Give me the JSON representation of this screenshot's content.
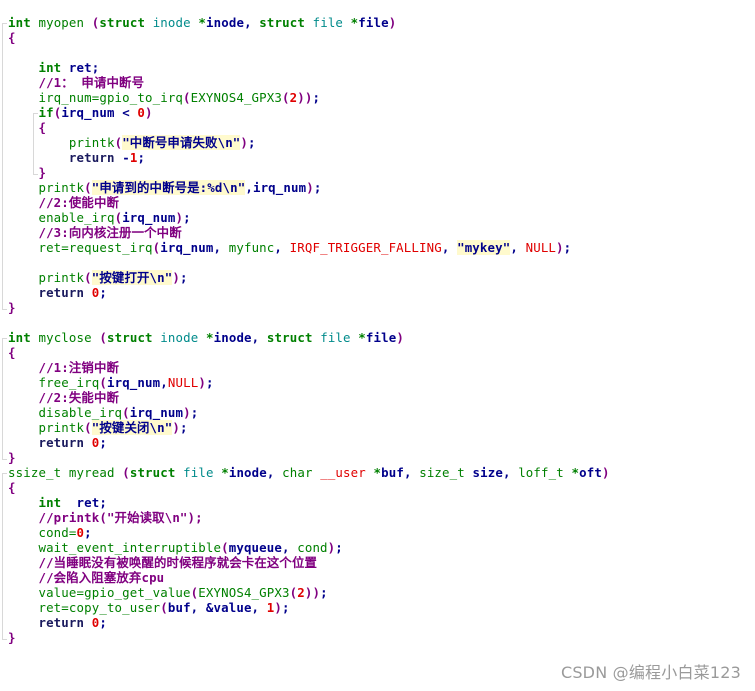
{
  "editor": {
    "colors": {
      "keyword": "#008000",
      "type": "#008b8b",
      "identifier": "#00008b",
      "number": "#e00000",
      "macro": "#e00000",
      "comment": "#800080",
      "string_highlight": "#fffacd"
    },
    "lines": [
      [
        [
          "kw",
          "int"
        ],
        [
          "plain",
          " "
        ],
        [
          "fn",
          "myopen"
        ],
        [
          "plain",
          " "
        ],
        [
          "punc",
          "("
        ],
        [
          "kw",
          "struct"
        ],
        [
          "plain",
          " "
        ],
        [
          "type",
          "inode"
        ],
        [
          "plain",
          " "
        ],
        [
          "kw",
          "*"
        ],
        [
          "ident",
          "inode"
        ],
        [
          "plain",
          ", "
        ],
        [
          "kw",
          "struct"
        ],
        [
          "plain",
          " "
        ],
        [
          "type",
          "file"
        ],
        [
          "plain",
          " "
        ],
        [
          "kw",
          "*"
        ],
        [
          "ident",
          "file"
        ],
        [
          "punc",
          ")"
        ]
      ],
      [
        [
          "punc",
          "{"
        ]
      ],
      [],
      [
        [
          "plain",
          "    "
        ],
        [
          "kw",
          "int"
        ],
        [
          "plain",
          " "
        ],
        [
          "ident",
          "ret;"
        ]
      ],
      [
        [
          "plain",
          "    "
        ],
        [
          "cmt",
          "//1： 申请中断号"
        ]
      ],
      [
        [
          "plain",
          "    "
        ],
        [
          "fn",
          "irq_num=gpio_to_irq"
        ],
        [
          "punc",
          "("
        ],
        [
          "fn",
          "EXYNOS4_GPX3"
        ],
        [
          "punc",
          "("
        ],
        [
          "num",
          "2"
        ],
        [
          "punc",
          "))"
        ],
        [
          "ident",
          ";"
        ]
      ],
      [
        [
          "plain",
          "    "
        ],
        [
          "kw",
          "if"
        ],
        [
          "punc",
          "("
        ],
        [
          "ident",
          "irq_num < "
        ],
        [
          "num",
          "0"
        ],
        [
          "punc",
          ")"
        ]
      ],
      [
        [
          "plain",
          "    "
        ],
        [
          "punc",
          "{"
        ]
      ],
      [
        [
          "plain",
          "        "
        ],
        [
          "fn",
          "printk"
        ],
        [
          "punc",
          "("
        ],
        [
          "str",
          "\"中断号申请失败\\n\""
        ],
        [
          "punc",
          ")"
        ],
        [
          "ident",
          ";"
        ]
      ],
      [
        [
          "plain",
          "        "
        ],
        [
          "ret",
          "return"
        ],
        [
          "plain",
          " "
        ],
        [
          "ident",
          "-"
        ],
        [
          "num",
          "1"
        ],
        [
          "ident",
          ";"
        ]
      ],
      [
        [
          "plain",
          "    "
        ],
        [
          "punc",
          "}"
        ]
      ],
      [
        [
          "plain",
          "    "
        ],
        [
          "fn",
          "printk"
        ],
        [
          "punc",
          "("
        ],
        [
          "str",
          "\"申请到的中断号是:%d\\n\""
        ],
        [
          "ident",
          ",irq_num"
        ],
        [
          "punc",
          ")"
        ],
        [
          "ident",
          ";"
        ]
      ],
      [
        [
          "plain",
          "    "
        ],
        [
          "cmt",
          "//2:使能中断"
        ]
      ],
      [
        [
          "plain",
          "    "
        ],
        [
          "fn",
          "enable_irq"
        ],
        [
          "punc",
          "("
        ],
        [
          "ident",
          "irq_num"
        ],
        [
          "punc",
          ")"
        ],
        [
          "ident",
          ";"
        ]
      ],
      [
        [
          "plain",
          "    "
        ],
        [
          "cmt",
          "//3:向内核注册一个中断"
        ]
      ],
      [
        [
          "plain",
          "    "
        ],
        [
          "fn",
          "ret=request_irq"
        ],
        [
          "punc",
          "("
        ],
        [
          "ident",
          "irq_num, "
        ],
        [
          "fn",
          "myfunc"
        ],
        [
          "ident",
          ", "
        ],
        [
          "red",
          "IRQF_TRIGGER_FALLING"
        ],
        [
          "ident",
          ", "
        ],
        [
          "str",
          "\"mykey\""
        ],
        [
          "ident",
          ", "
        ],
        [
          "red",
          "NULL"
        ],
        [
          "punc",
          ")"
        ],
        [
          "ident",
          ";"
        ]
      ],
      [],
      [
        [
          "plain",
          "    "
        ],
        [
          "fn",
          "printk"
        ],
        [
          "punc",
          "("
        ],
        [
          "str",
          "\"按键打开\\n\""
        ],
        [
          "punc",
          ")"
        ],
        [
          "ident",
          ";"
        ]
      ],
      [
        [
          "plain",
          "    "
        ],
        [
          "ret",
          "return"
        ],
        [
          "plain",
          " "
        ],
        [
          "num",
          "0"
        ],
        [
          "ident",
          ";"
        ]
      ],
      [
        [
          "punc",
          "}"
        ]
      ],
      [],
      [
        [
          "kw",
          "int"
        ],
        [
          "plain",
          " "
        ],
        [
          "fn",
          "myclose"
        ],
        [
          "plain",
          " "
        ],
        [
          "punc",
          "("
        ],
        [
          "kw",
          "struct"
        ],
        [
          "plain",
          " "
        ],
        [
          "type",
          "inode"
        ],
        [
          "plain",
          " "
        ],
        [
          "kw",
          "*"
        ],
        [
          "ident",
          "inode"
        ],
        [
          "plain",
          ", "
        ],
        [
          "kw",
          "struct"
        ],
        [
          "plain",
          " "
        ],
        [
          "type",
          "file"
        ],
        [
          "plain",
          " "
        ],
        [
          "kw",
          "*"
        ],
        [
          "ident",
          "file"
        ],
        [
          "punc",
          ")"
        ]
      ],
      [
        [
          "punc",
          "{"
        ]
      ],
      [
        [
          "plain",
          "    "
        ],
        [
          "cmt",
          "//1:注销中断"
        ]
      ],
      [
        [
          "plain",
          "    "
        ],
        [
          "fn",
          "free_irq"
        ],
        [
          "punc",
          "("
        ],
        [
          "ident",
          "irq_num,"
        ],
        [
          "red",
          "NULL"
        ],
        [
          "punc",
          ")"
        ],
        [
          "ident",
          ";"
        ]
      ],
      [
        [
          "plain",
          "    "
        ],
        [
          "cmt",
          "//2:失能中断"
        ]
      ],
      [
        [
          "plain",
          "    "
        ],
        [
          "fn",
          "disable_irq"
        ],
        [
          "punc",
          "("
        ],
        [
          "ident",
          "irq_num"
        ],
        [
          "punc",
          ")"
        ],
        [
          "ident",
          ";"
        ]
      ],
      [
        [
          "plain",
          "    "
        ],
        [
          "fn",
          "printk"
        ],
        [
          "punc",
          "("
        ],
        [
          "str",
          "\"按键关闭\\n\""
        ],
        [
          "punc",
          ")"
        ],
        [
          "ident",
          ";"
        ]
      ],
      [
        [
          "plain",
          "    "
        ],
        [
          "ret",
          "return"
        ],
        [
          "plain",
          " "
        ],
        [
          "num",
          "0"
        ],
        [
          "ident",
          ";"
        ]
      ],
      [
        [
          "punc",
          "}"
        ]
      ],
      [
        [
          "fn",
          "ssize_t"
        ],
        [
          "plain",
          " "
        ],
        [
          "fn",
          "myread"
        ],
        [
          "plain",
          " "
        ],
        [
          "punc",
          "("
        ],
        [
          "kw",
          "struct"
        ],
        [
          "plain",
          " "
        ],
        [
          "type",
          "file"
        ],
        [
          "plain",
          " "
        ],
        [
          "kw",
          "*"
        ],
        [
          "ident",
          "inode"
        ],
        [
          "plain",
          ", "
        ],
        [
          "fn",
          "char"
        ],
        [
          "plain",
          " "
        ],
        [
          "red",
          "__user"
        ],
        [
          "plain",
          " "
        ],
        [
          "kw",
          "*"
        ],
        [
          "ident",
          "buf"
        ],
        [
          "plain",
          ", "
        ],
        [
          "fn",
          "size_t"
        ],
        [
          "plain",
          " "
        ],
        [
          "ident",
          "size"
        ],
        [
          "plain",
          ", "
        ],
        [
          "fn",
          "loff_t"
        ],
        [
          "plain",
          " "
        ],
        [
          "kw",
          "*"
        ],
        [
          "ident",
          "oft"
        ],
        [
          "punc",
          ")"
        ]
      ],
      [
        [
          "punc",
          "{"
        ]
      ],
      [
        [
          "plain",
          "    "
        ],
        [
          "kw",
          "int"
        ],
        [
          "plain",
          "  "
        ],
        [
          "ident",
          "ret;"
        ]
      ],
      [
        [
          "plain",
          "    "
        ],
        [
          "cmt",
          "//printk(\"开始读取\\n\");"
        ]
      ],
      [
        [
          "plain",
          "    "
        ],
        [
          "fn",
          "cond="
        ],
        [
          "num",
          "0"
        ],
        [
          "ident",
          ";"
        ]
      ],
      [
        [
          "plain",
          "    "
        ],
        [
          "fn",
          "wait_event_interruptible"
        ],
        [
          "punc",
          "("
        ],
        [
          "ident",
          "myqueue, "
        ],
        [
          "fn",
          "cond"
        ],
        [
          "punc",
          ")"
        ],
        [
          "ident",
          ";"
        ]
      ],
      [
        [
          "plain",
          "    "
        ],
        [
          "cmt",
          "//当睡眠没有被唤醒的时候程序就会卡在这个位置"
        ]
      ],
      [
        [
          "plain",
          "    "
        ],
        [
          "cmt",
          "//会陷入阻塞放弃cpu"
        ]
      ],
      [
        [
          "plain",
          "    "
        ],
        [
          "fn",
          "value=gpio_get_value"
        ],
        [
          "punc",
          "("
        ],
        [
          "fn",
          "EXYNOS4_GPX3"
        ],
        [
          "punc",
          "("
        ],
        [
          "num",
          "2"
        ],
        [
          "punc",
          "))"
        ],
        [
          "ident",
          ";"
        ]
      ],
      [
        [
          "plain",
          "    "
        ],
        [
          "fn",
          "ret=copy_to_user"
        ],
        [
          "punc",
          "("
        ],
        [
          "ident",
          "buf, &value, "
        ],
        [
          "num",
          "1"
        ],
        [
          "punc",
          ")"
        ],
        [
          "ident",
          ";"
        ]
      ],
      [
        [
          "plain",
          "    "
        ],
        [
          "ret",
          "return"
        ],
        [
          "plain",
          " "
        ],
        [
          "num",
          "0"
        ],
        [
          "ident",
          ";"
        ]
      ],
      [
        [
          "punc",
          "}"
        ]
      ]
    ]
  },
  "watermark": "CSDN @编程小白菜123"
}
